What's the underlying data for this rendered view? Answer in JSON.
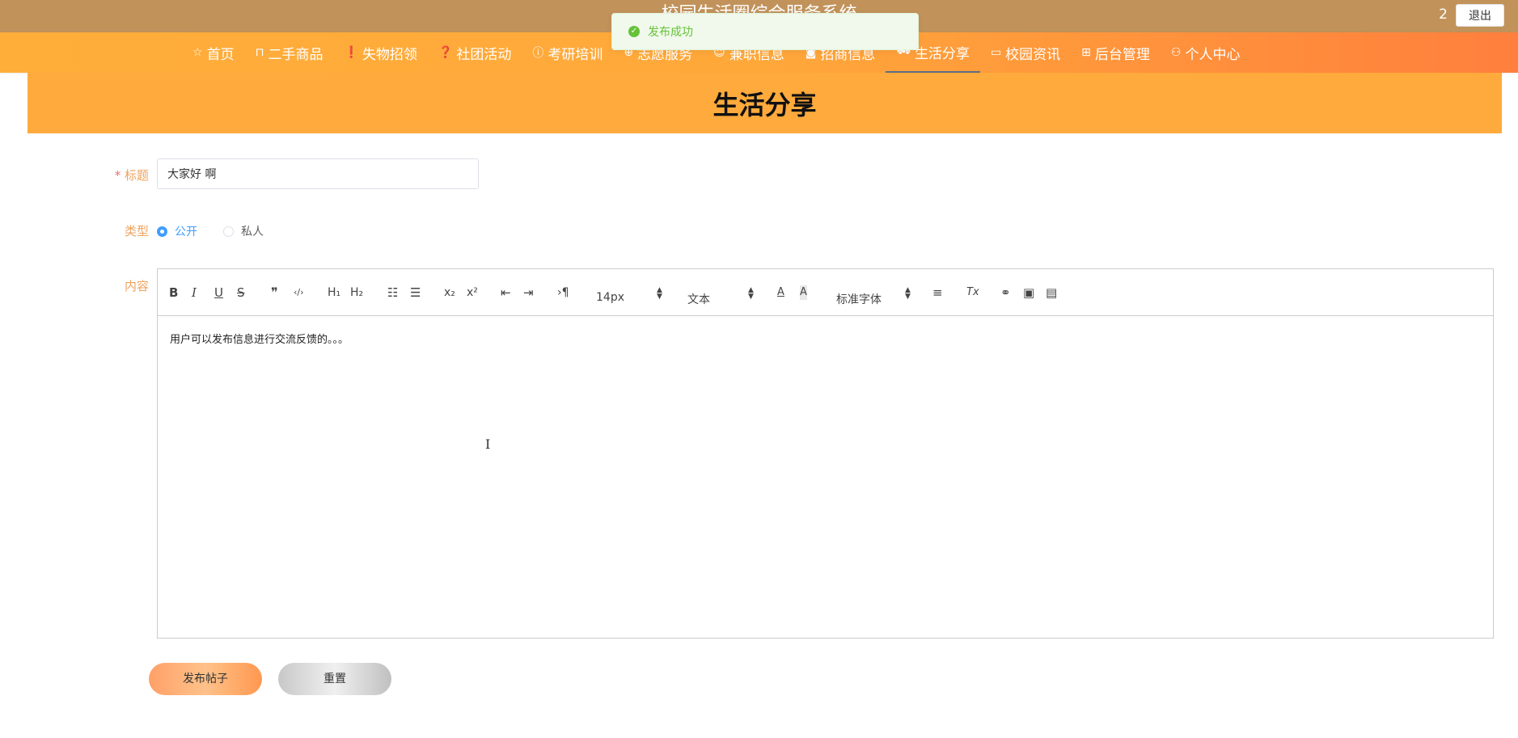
{
  "header": {
    "site_title": "校园生活圈综合服务系统",
    "user_count": "2",
    "logout_label": "退出"
  },
  "nav": {
    "items": [
      {
        "label": "首页",
        "icon": "star-icon"
      },
      {
        "label": "二手商品",
        "icon": "bag-icon"
      },
      {
        "label": "失物招领",
        "icon": "info-icon"
      },
      {
        "label": "社团活动",
        "icon": "question-icon"
      },
      {
        "label": "考研培训",
        "icon": "info-icon"
      },
      {
        "label": "志愿服务",
        "icon": "globe-icon"
      },
      {
        "label": "兼职信息",
        "icon": "smile-icon"
      },
      {
        "label": "招商信息",
        "icon": "camera-icon"
      },
      {
        "label": "生活分享",
        "icon": "car-icon",
        "active": true
      },
      {
        "label": "校园资讯",
        "icon": "video-icon"
      },
      {
        "label": "后台管理",
        "icon": "gift-icon"
      },
      {
        "label": "个人中心",
        "icon": "user-icon"
      }
    ]
  },
  "toast": {
    "message": "发布成功",
    "icon": "check-circle-icon"
  },
  "page": {
    "title": "生活分享"
  },
  "form": {
    "title_label": "标题",
    "title_required_mark": "*",
    "title_value": "大家好 啊",
    "type_label": "类型",
    "type_options": [
      {
        "label": "公开",
        "checked": true
      },
      {
        "label": "私人",
        "checked": false
      }
    ],
    "content_label": "内容",
    "content_text": "用户可以发布信息进行交流反馈的。。。",
    "submit_label": "发布帖子",
    "reset_label": "重置"
  },
  "toolbar": {
    "bold": "B",
    "italic": "I",
    "underline": "U",
    "strike": "S",
    "blockquote": "❞",
    "code": "‹/›",
    "h1": "H₁",
    "h2": "H₂",
    "subscript": "x₂",
    "superscript": "x²",
    "direction": "›¶",
    "font_size": "14px",
    "header_select": "文本",
    "font_family": "标准字体",
    "clean": "Tx"
  },
  "colors": {
    "topbar": "#c1925a",
    "nav_start": "#ffae3a",
    "nav_end": "#ff7f3d",
    "banner": "#ffaa3c",
    "label": "#f0a35c",
    "radio_active": "#409eff",
    "toast_text": "#67c23a"
  }
}
